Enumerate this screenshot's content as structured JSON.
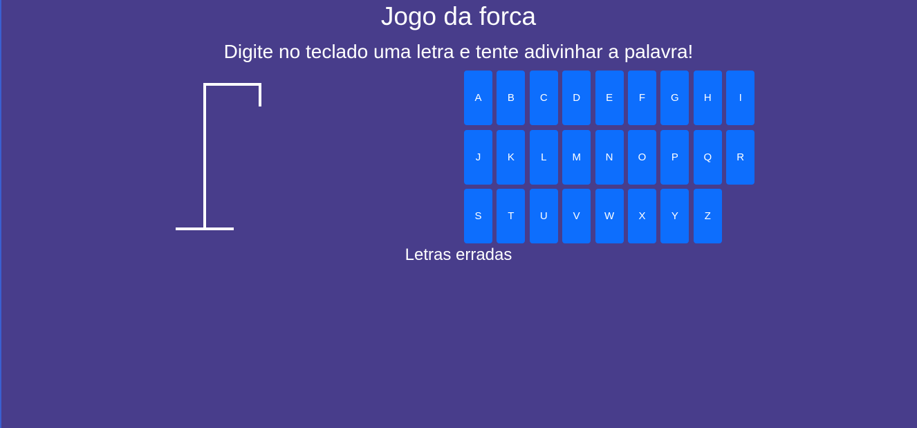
{
  "header": {
    "title": "Jogo da forca",
    "instructions": "Digite no teclado uma letra e tente adivinhar a palavra!"
  },
  "keyboard": {
    "rows": [
      [
        "A",
        "B",
        "C",
        "D",
        "E",
        "F",
        "G",
        "H",
        "I"
      ],
      [
        "J",
        "K",
        "L",
        "M",
        "N",
        "O",
        "P",
        "Q",
        "R"
      ],
      [
        "S",
        "T",
        "U",
        "V",
        "W",
        "X",
        "Y",
        "Z"
      ]
    ],
    "key_color": "#0d6efd"
  },
  "wrong_letters": {
    "label": "Letras erradas",
    "letters": ""
  },
  "theme": {
    "background": "#483d8b",
    "text": "#ffffff"
  }
}
